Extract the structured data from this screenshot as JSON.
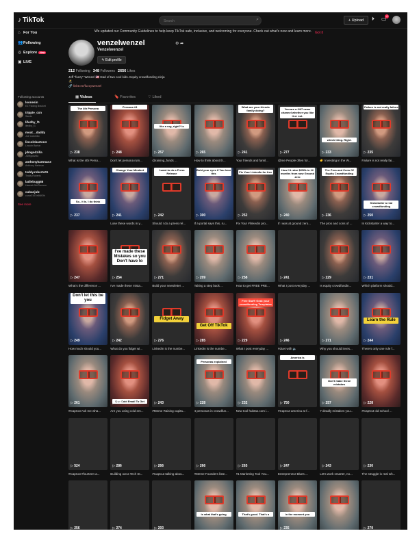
{
  "topbar": {
    "logo": "TikTok",
    "search_placeholder": "Search",
    "upload_label": "+ Upload",
    "inbox_badge": "4"
  },
  "nav": [
    {
      "label": "For You",
      "icon": "home-icon",
      "glyph": "⌂"
    },
    {
      "label": "Following",
      "icon": "following-icon",
      "glyph": "👥"
    },
    {
      "label": "Explore",
      "icon": "explore-icon",
      "glyph": "◎",
      "badge": "New"
    },
    {
      "label": "LIVE",
      "icon": "live-icon",
      "glyph": "▣"
    }
  ],
  "following_title": "Following accounts",
  "accounts": [
    {
      "username": "loonesin",
      "name": "EZ Folding Bracket"
    },
    {
      "username": "trippie_cxn",
      "name": "Sando"
    },
    {
      "username": "lifedby_f1",
      "name": "lifedby_f1"
    },
    {
      "username": "moat__daddy",
      "name": "Joe Colombo"
    },
    {
      "username": "lincolnbarton4",
      "name": "Lincoln Barton"
    },
    {
      "username": "jdmgodzilla",
      "name": "JDMgodzilla"
    },
    {
      "username": "anthonyhartman3",
      "name": "Anthony Hartman"
    },
    {
      "username": "teddy.roberts01",
      "name": "Teddy Roberts"
    },
    {
      "username": "ladiebugg88",
      "name": "Hannah McPherson"
    },
    {
      "username": "cubanjulz",
      "name": "cuma7457e5t6f2fh"
    }
  ],
  "see_more": "See more",
  "notice": {
    "text": "We updated our Community Guidelines to help keep TikTok safe, inclusive, and welcoming for everyone. Check out what's new and learn more.",
    "action": "Got it"
  },
  "profile": {
    "username": "venzelwenzel",
    "nickname": "Venzelwenzel",
    "edit_label": "Edit profile",
    "following_count": "212",
    "following_label": "Following",
    "followers_count": "348",
    "followers_label": "Followers",
    "likes_count": "2656",
    "likes_label": "Likes",
    "bio": "Jeff \"fuzzy\" Wenzel 🇺🇸 Dad of two cool kids. Equity crowdfunding ninja",
    "bio_extra": "🥷",
    "link": "🔗 linktr.ee/fuzzywenzel"
  },
  "tabs": {
    "videos": "Videos",
    "favorites": "Favorites",
    "liked": "Liked"
  },
  "videos": [
    {
      "views": "238",
      "title": "What is the 4th Perso...",
      "caption": "The 4th Persona",
      "captionPos": 2,
      "captionClass": "",
      "style": ""
    },
    {
      "views": "248",
      "title": "Don't let persona rum...",
      "caption": "Persona #3",
      "captionPos": 0,
      "captionClass": "",
      "style": "red"
    },
    {
      "views": "257",
      "title": "@raising_funds ...",
      "caption": "like a rug, right? lo",
      "captionPos": 28,
      "captionClass": "",
      "style": "light"
    },
    {
      "views": "265",
      "title": "How to think about th...",
      "caption": "",
      "captionPos": 0,
      "captionClass": "",
      "style": "light"
    },
    {
      "views": "241",
      "title": "Your friends and famil...",
      "caption": "What are your friends family doing?",
      "captionPos": 0,
      "captionClass": "",
      "style": ""
    },
    {
      "views": "277",
      "title": "@me People often for...",
      "caption": "You are a 24/7 news channel whether you like it or not.",
      "captionPos": 3,
      "captionClass": "",
      "style": "dark"
    },
    {
      "views": "233",
      "title": "👉 Investing in the W...",
      "caption": "which thing. Right.",
      "captionPos": 48,
      "captionClass": "",
      "style": "light"
    },
    {
      "views": "235",
      "title": "Failure is not really fai...",
      "caption": "Failure is not really failure",
      "captionPos": 0,
      "captionClass": "",
      "style": ""
    },
    {
      "views": "237",
      "title": "",
      "caption": "So.. it is. I do think",
      "captionPos": 46,
      "captionClass": "",
      "style": "blue"
    },
    {
      "views": "241",
      "title": "Lose these words in y...",
      "caption": "Change Your Mindset",
      "captionPos": 0,
      "captionClass": "",
      "style": "blue"
    },
    {
      "views": "242",
      "title": "Should I do a press rel...",
      "caption": "I want to do a Press Release",
      "captionPos": 0,
      "captionClass": "",
      "style": "dark"
    },
    {
      "views": "300",
      "title": "If a portal says this, ru...",
      "caption": "Bold your eyes if You hear this",
      "captionPos": 0,
      "captionClass": "",
      "style": "blue"
    },
    {
      "views": "252",
      "title": "Fix Your #linkedin pro...",
      "caption": "Fix Your LinkedIn for free",
      "captionPos": 3,
      "captionClass": "",
      "style": ""
    },
    {
      "views": "240",
      "title": "If i was at ground zero...",
      "caption": "How I'd raise $250k in 12 months from now Ground zero",
      "captionPos": 0,
      "captionClass": "",
      "style": "light"
    },
    {
      "views": "236",
      "title": "The pros and cons of ...",
      "caption": "The Pros and Cons Of Equity Crowdfunding",
      "captionPos": 0,
      "captionClass": "",
      "style": ""
    },
    {
      "views": "250",
      "title": "Is Kickstarter a way to...",
      "caption": "Kickstarter a real crowdfunding",
      "captionPos": 48,
      "captionClass": "",
      "style": "blue"
    },
    {
      "views": "247",
      "title": "What's the difference ...",
      "caption": "",
      "captionPos": 0,
      "captionClass": "",
      "style": "red"
    },
    {
      "views": "254",
      "title": "I've made these mista...",
      "caption": "I've made these Mistakes so you Don't have to",
      "captionPos": 28,
      "captionClass": "big",
      "style": "dark"
    },
    {
      "views": "271",
      "title": "Build your newsletter ...",
      "caption": "",
      "captionPos": 0,
      "captionClass": "",
      "style": ""
    },
    {
      "views": "209",
      "title": "Taking a step back ...",
      "caption": "",
      "captionPos": 0,
      "captionClass": "",
      "style": "light"
    },
    {
      "views": "258",
      "title": "How to get FREE PRE...",
      "caption": "",
      "captionPos": 0,
      "captionClass": "",
      "style": "light"
    },
    {
      "views": "241",
      "title": "What I post everyday ...",
      "caption": "",
      "captionPos": 0,
      "captionClass": "",
      "style": "dark"
    },
    {
      "views": "229",
      "title": "Is equity crowdfundin...",
      "caption": "",
      "captionPos": 0,
      "captionClass": "",
      "style": ""
    },
    {
      "views": "231",
      "title": "Which platform should...",
      "caption": "",
      "captionPos": 0,
      "captionClass": "",
      "style": "blue"
    },
    {
      "views": "249",
      "title": "How much should you...",
      "caption": "Don't let this be you",
      "captionPos": 0,
      "captionClass": "big",
      "style": "blue"
    },
    {
      "views": "242",
      "title": "What do you fidget wi...",
      "caption": "",
      "captionPos": 0,
      "captionClass": "",
      "style": ""
    },
    {
      "views": "276",
      "title": "LinkedIn is the numbe...",
      "caption": "Fidget Away",
      "captionPos": 34,
      "captionClass": "y big",
      "style": "dark"
    },
    {
      "views": "285",
      "title": "LinkedIn is the numbe...",
      "caption": "Get Off TikTok",
      "captionPos": 44,
      "captionClass": "y big",
      "style": "red"
    },
    {
      "views": "229",
      "title": "What I post everyday ...",
      "caption": "Free Stuff! Grab your crowdfunding Templates",
      "captionPos": 8,
      "captionClass": "r",
      "style": "red"
    },
    {
      "views": "246",
      "title": "#duet with 🔈",
      "caption": "",
      "captionPos": 0,
      "captionClass": "",
      "style": "dark"
    },
    {
      "views": "271",
      "title": "Why you should inves...",
      "caption": "",
      "captionPos": 0,
      "captionClass": "",
      "style": "light"
    },
    {
      "views": "244",
      "title": "There's only one rule f...",
      "caption": "Learn the Rule",
      "captionPos": 36,
      "captionClass": "y big",
      "style": "blue"
    },
    {
      "views": "261",
      "title": "#CapCut Ask me wha...",
      "caption": "",
      "captionPos": 0,
      "captionClass": "",
      "style": "light"
    },
    {
      "views": "238",
      "title": "Are you using cold em...",
      "caption": "Use Cold Email To Get",
      "captionPos": 64,
      "captionClass": "",
      "style": "red"
    },
    {
      "views": "243",
      "title": "#Meme Raising capita...",
      "caption": "",
      "captionPos": 0,
      "captionClass": "",
      "style": "dark"
    },
    {
      "views": "228",
      "title": "4 personas in crowdfun...",
      "caption": "Personas explained",
      "captionPos": 6,
      "captionClass": "",
      "style": "light"
    },
    {
      "views": "232",
      "title": "New tool hubtas.com i...",
      "caption": "",
      "captionPos": 0,
      "captionClass": "",
      "style": "light"
    },
    {
      "views": "750",
      "title": "#CapCut america at f...",
      "caption": "America is",
      "captionPos": 0,
      "captionClass": "",
      "style": "dark"
    },
    {
      "views": "257",
      "title": "7 deadly mistakes you...",
      "caption": "Don't make these mistakes",
      "captionPos": 34,
      "captionClass": "",
      "style": "light"
    },
    {
      "views": "228",
      "title": "#CapCut old school ...",
      "caption": "",
      "captionPos": 0,
      "captionClass": "",
      "style": "red"
    },
    {
      "views": "524",
      "title": "#CapCut #fourteen a...",
      "caption": "",
      "captionPos": 0,
      "captionClass": "",
      "style": "dark"
    },
    {
      "views": "286",
      "title": "Building out a Tech St...",
      "caption": "",
      "captionPos": 0,
      "captionClass": "",
      "style": "dark"
    },
    {
      "views": "266",
      "title": "#CapCut talking abou...",
      "caption": "",
      "captionPos": 0,
      "captionClass": "",
      "style": "dark"
    },
    {
      "views": "266",
      "title": "#Meme Founders liste...",
      "caption": "",
      "captionPos": 0,
      "captionClass": "",
      "style": "dark"
    },
    {
      "views": "265",
      "title": "#1 Marketing Tool You...",
      "caption": "",
      "captionPos": 0,
      "captionClass": "",
      "style": "dark"
    },
    {
      "views": "247",
      "title": "Entrepreneur Blues ...",
      "caption": "",
      "captionPos": 0,
      "captionClass": "",
      "style": "dark"
    },
    {
      "views": "243",
      "title": "Let's work smarter, no...",
      "caption": "",
      "captionPos": 0,
      "captionClass": "",
      "style": "dark"
    },
    {
      "views": "230",
      "title": "The struggle is real wh...",
      "caption": "",
      "captionPos": 0,
      "captionClass": "",
      "style": "dark"
    },
    {
      "views": "256",
      "title": "",
      "caption": "",
      "captionPos": 0,
      "captionClass": "",
      "style": "dark"
    },
    {
      "views": "274",
      "title": "",
      "caption": "",
      "captionPos": 0,
      "captionClass": "",
      "style": "dark"
    },
    {
      "views": "293",
      "title": "",
      "caption": "",
      "captionPos": 0,
      "captionClass": "",
      "style": "dark"
    },
    {
      "views": "",
      "title": "",
      "caption": "is what that's going",
      "captionPos": 46,
      "captionClass": "",
      "style": "light"
    },
    {
      "views": "",
      "title": "",
      "caption": "That's good. That's a",
      "captionPos": 46,
      "captionClass": "",
      "style": "light"
    },
    {
      "views": "235",
      "title": "",
      "caption": "in the moment you",
      "captionPos": 46,
      "captionClass": "",
      "style": "light"
    },
    {
      "views": "",
      "title": "",
      "caption": "",
      "captionPos": 0,
      "captionClass": "",
      "style": "light"
    },
    {
      "views": "279",
      "title": "",
      "caption": "",
      "captionPos": 0,
      "captionClass": "",
      "style": "dark"
    }
  ]
}
